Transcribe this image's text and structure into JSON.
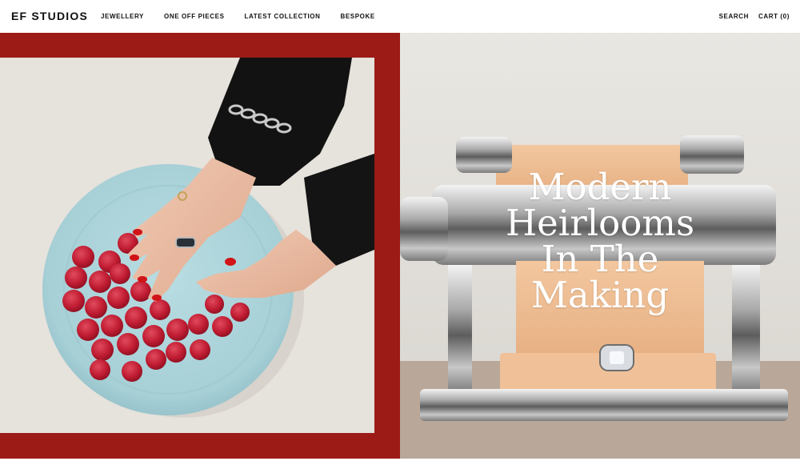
{
  "header": {
    "logo": "EF STUDIOS",
    "nav": [
      "JEWELLERY",
      "ONE OFF PIECES",
      "LATEST COLLECTION",
      "BESPOKE"
    ],
    "search": "SEARCH",
    "cart": "CART (0)"
  },
  "hero": {
    "title_lines": [
      "Modern",
      "Heirlooms",
      "In The",
      "Making"
    ]
  },
  "colors": {
    "accent_red": "#9c1b17",
    "plate_blue": "#a9d3d9",
    "raspberry": "#c01c32",
    "nail_red": "#d01418"
  },
  "images": {
    "left": "hands-with-rings-on-plate-of-raspberries",
    "right": "pasta-machine-with-ring-and-dough"
  }
}
